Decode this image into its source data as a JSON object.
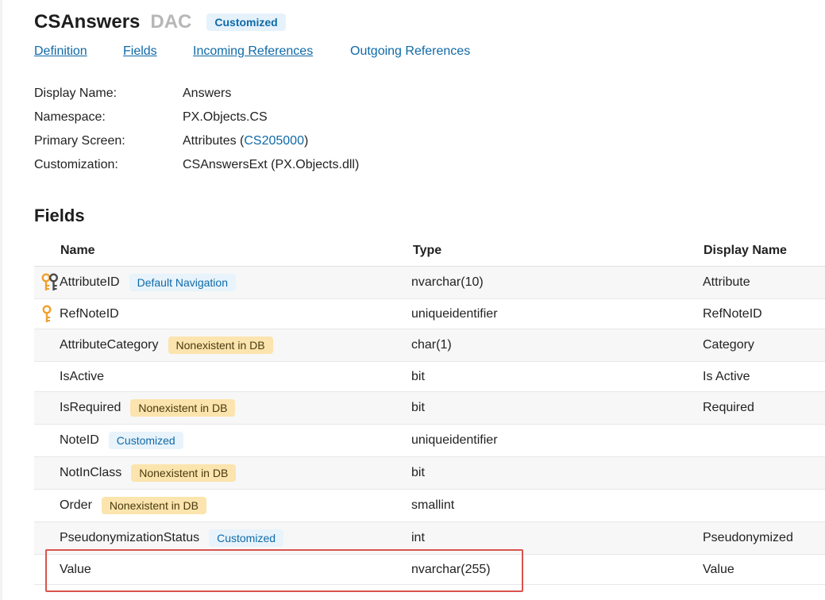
{
  "header": {
    "title": "CSAnswers",
    "subtitle": "DAC",
    "badge": "Customized"
  },
  "nav": {
    "tabs": [
      {
        "label": "Definition"
      },
      {
        "label": "Fields"
      },
      {
        "label": "Incoming References"
      },
      {
        "label": "Outgoing References"
      }
    ]
  },
  "info": {
    "display_name_label": "Display Name:",
    "display_name_value": "Answers",
    "namespace_label": "Namespace:",
    "namespace_value": "PX.Objects.CS",
    "primary_screen_label": "Primary Screen:",
    "primary_screen_name": "Attributes (",
    "primary_screen_id": "CS205000",
    "primary_screen_close": ")",
    "customization_label": "Customization:",
    "customization_value": "CSAnswersExt (PX.Objects.dll)"
  },
  "fields_section": {
    "title": "Fields",
    "columns": {
      "name": "Name",
      "type": "Type",
      "display_name": "Display Name"
    },
    "rows": [
      {
        "name": "AttributeID",
        "badge": "Default Navigation",
        "type": "nvarchar(10)",
        "display_name": "Attribute"
      },
      {
        "name": "RefNoteID",
        "badge": "",
        "type": "uniqueidentifier",
        "display_name": "RefNoteID"
      },
      {
        "name": "AttributeCategory",
        "badge": "Nonexistent in DB",
        "type": "char(1)",
        "display_name": "Category"
      },
      {
        "name": "IsActive",
        "badge": "",
        "type": "bit",
        "display_name": "Is Active"
      },
      {
        "name": "IsRequired",
        "badge": "Nonexistent in DB",
        "type": "bit",
        "display_name": "Required"
      },
      {
        "name": "NoteID",
        "badge": "Customized",
        "type": "uniqueidentifier",
        "display_name": ""
      },
      {
        "name": "NotInClass",
        "badge": "Nonexistent in DB",
        "type": "bit",
        "display_name": ""
      },
      {
        "name": "Order",
        "badge": "Nonexistent in DB",
        "type": "smallint",
        "display_name": ""
      },
      {
        "name": "PseudonymizationStatus",
        "badge": "Customized",
        "type": "int",
        "display_name": "Pseudonymized"
      },
      {
        "name": "Value",
        "badge": "",
        "type": "nvarchar(255)",
        "display_name": "Value"
      }
    ]
  },
  "icons": {
    "row0": "double-key-icon",
    "row1": "key-icon"
  },
  "colors": {
    "link": "#0f6aa8",
    "badge_blue_bg": "#e8f3fb",
    "badge_yellow_bg": "#fbe4ad",
    "key": "#f0a030",
    "key_dark": "#4a4a4a",
    "highlight": "#d9534f"
  }
}
